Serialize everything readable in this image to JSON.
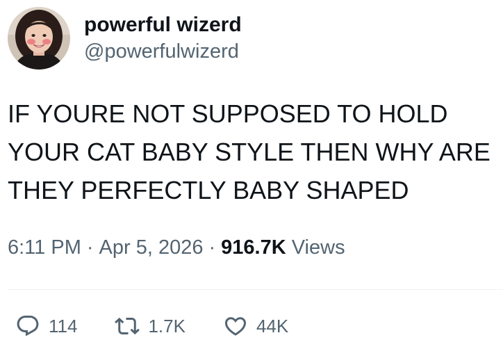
{
  "author": {
    "display_name": "powerful wizerd",
    "handle": "@powerfulwizerd",
    "avatar_icon": "profile-photo"
  },
  "tweet": {
    "text": "IF YOURE NOT SUPPOSED TO HOLD\nYOUR CAT BABY STYLE THEN WHY ARE\nTHEY PERFECTLY BABY SHAPED"
  },
  "meta": {
    "time": "6:11 PM",
    "separator": "·",
    "date": "Apr 5, 2026",
    "views_count": "916.7K",
    "views_label": "Views"
  },
  "actions": {
    "replies": {
      "icon": "reply-icon",
      "count": "114"
    },
    "retweets": {
      "icon": "retweet-icon",
      "count": "1.7K"
    },
    "likes": {
      "icon": "heart-icon",
      "count": "44K"
    }
  },
  "colors": {
    "primary_text": "#0f1419",
    "secondary_text": "#536471",
    "divider": "#eff3f4"
  }
}
